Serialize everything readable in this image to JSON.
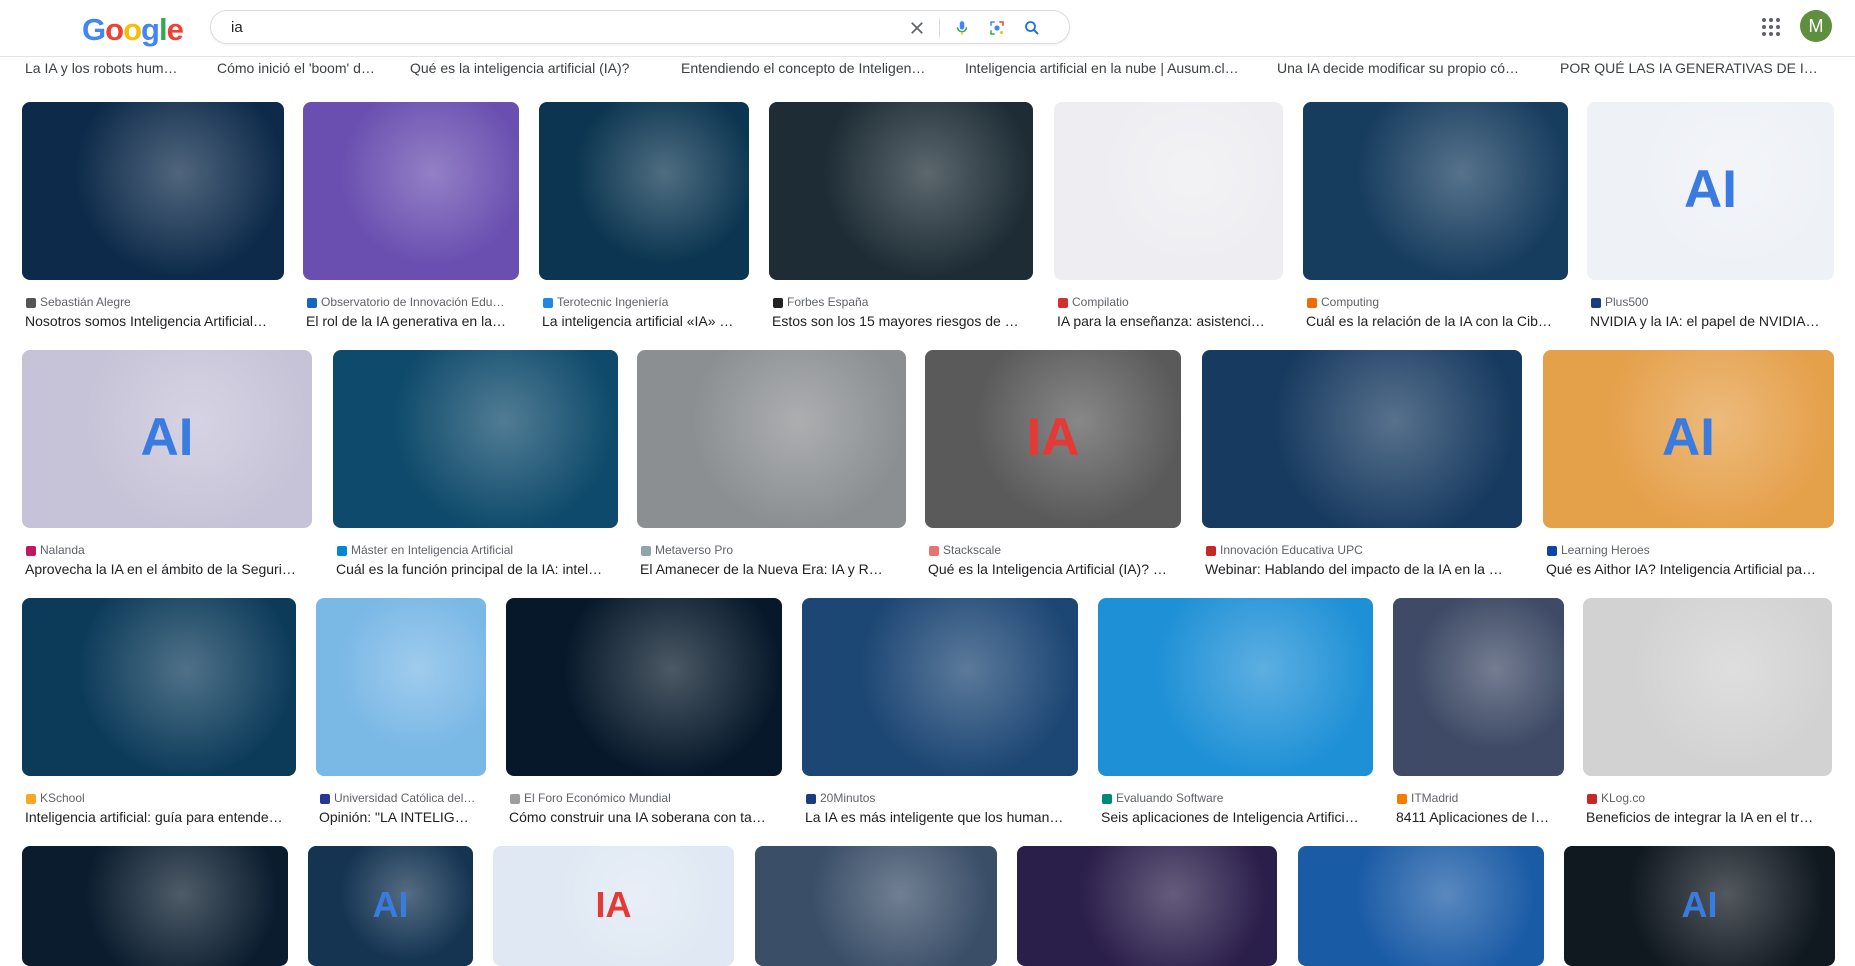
{
  "header": {
    "logo": "Google",
    "search_value": "ia",
    "avatar_letter": "M",
    "accent": "#1a73e8"
  },
  "prev_titles": [
    "La IA y los robots hum…",
    "Cómo inició el 'boom' d…",
    "Qué es la inteligencia artificial (IA)?",
    "Entendiendo el concepto de Inteligen…",
    "Inteligencia artificial en la nube | Ausum.cl…",
    "Una IA decide modificar su propio có…",
    "POR QUÉ LAS IA GENERATIVAS DE I…"
  ],
  "results": [
    {
      "source": "Sebastián Alegre",
      "title": "Nosotros somos Inteligencia Artificial…",
      "overlay": "",
      "color": "#0d2a4a",
      "favicon": "#555555"
    },
    {
      "source": "Observatorio de Innovación Edu…",
      "title": "El rol de la IA generativa en la…",
      "overlay": "",
      "color": "#6a4fb0",
      "favicon": "#1565c0"
    },
    {
      "source": "Terotecnic Ingeniería",
      "title": "La inteligencia artificial «IA» …",
      "overlay": "",
      "color": "#0b3550",
      "favicon": "#1e88e5"
    },
    {
      "source": "Forbes España",
      "title": "Estos son los 15 mayores riesgos de …",
      "overlay": "",
      "color": "#1d2c35",
      "favicon": "#222222"
    },
    {
      "source": "Compilatio",
      "title": "IA para la enseñanza: asistenci…",
      "overlay": "",
      "color": "#eeeef2",
      "favicon": "#d32f2f"
    },
    {
      "source": "Computing",
      "title": "Cuál es la relación de la IA con la Cib…",
      "overlay": "",
      "color": "#163c5e",
      "favicon": "#ef6c00"
    },
    {
      "source": "Plus500",
      "title": "NVIDIA y la IA: el papel de NVIDIA…",
      "overlay": "AI",
      "color": "#eef1f6",
      "favicon": "#1a3d7c"
    },
    {
      "source": "Nalanda",
      "title": "Aprovecha la IA en el ámbito de la Seguri…",
      "overlay": "AI",
      "color": "#c6c3d8",
      "favicon": "#c2185b"
    },
    {
      "source": "Máster en Inteligencia Artificial",
      "title": "Cuál es la función principal de la IA: intel…",
      "overlay": "",
      "color": "#0e4a6b",
      "favicon": "#0288d1"
    },
    {
      "source": "Metaverso Pro",
      "title": "El Amanecer de la Nueva Era: IA y R…",
      "overlay": "",
      "color": "#8c8f92",
      "favicon": "#90a4ae"
    },
    {
      "source": "Stackscale",
      "title": "Qué es la Inteligencia Artificial (IA)? …",
      "overlay": "IA",
      "color": "#5a5a5a",
      "favicon": "#e57373"
    },
    {
      "source": "Innovación Educativa UPC",
      "title": "Webinar: Hablando del impacto de la IA en la …",
      "overlay": "",
      "color": "#173a60",
      "favicon": "#c62828"
    },
    {
      "source": "Learning Heroes",
      "title": "Qué es Aithor IA? Inteligencia Artificial pa…",
      "overlay": "AI",
      "color": "#e5a04a",
      "favicon": "#0d47a1"
    },
    {
      "source": "KSchool",
      "title": "Inteligencia artificial: guía para entende…",
      "overlay": "",
      "color": "#0c3b5a",
      "favicon": "#f9a825"
    },
    {
      "source": "Universidad Católica del…",
      "title": "Opinión: \"LA INTELIG…",
      "overlay": "",
      "color": "#7ab8e6",
      "favicon": "#283593"
    },
    {
      "source": "El Foro Económico Mundial",
      "title": "Cómo construir una IA soberana con ta…",
      "overlay": "",
      "color": "#06182a",
      "favicon": "#9e9e9e"
    },
    {
      "source": "20Minutos",
      "title": "La IA es más inteligente que los human…",
      "overlay": "",
      "color": "#1c4674",
      "favicon": "#1a3d7c"
    },
    {
      "source": "Evaluando Software",
      "title": "Seis aplicaciones de Inteligencia Artifici…",
      "overlay": "",
      "color": "#1e90d6",
      "favicon": "#00897b"
    },
    {
      "source": "ITMadrid",
      "title": "8411 Aplicaciones de I…",
      "overlay": "",
      "color": "#3e4a66",
      "favicon": "#f57c00"
    },
    {
      "source": "KLog.co",
      "title": "Beneficios de integrar la IA en el tr…",
      "overlay": "",
      "color": "#d2d2d2",
      "favicon": "#c62828"
    },
    {
      "source": "",
      "title": "",
      "overlay": "",
      "color": "#0a1c2e",
      "favicon": ""
    },
    {
      "source": "",
      "title": "",
      "overlay": "AI",
      "color": "#143452",
      "favicon": ""
    },
    {
      "source": "",
      "title": "",
      "overlay": "IA",
      "color": "#dfe8f3",
      "favicon": ""
    },
    {
      "source": "",
      "title": "",
      "overlay": "",
      "color": "#3a4e68",
      "favicon": ""
    },
    {
      "source": "",
      "title": "",
      "overlay": "",
      "color": "#2a1e4a",
      "favicon": ""
    },
    {
      "source": "",
      "title": "",
      "overlay": "",
      "color": "#1a5ba6",
      "favicon": ""
    },
    {
      "source": "",
      "title": "",
      "overlay": "AI",
      "color": "#101820",
      "favicon": ""
    }
  ]
}
